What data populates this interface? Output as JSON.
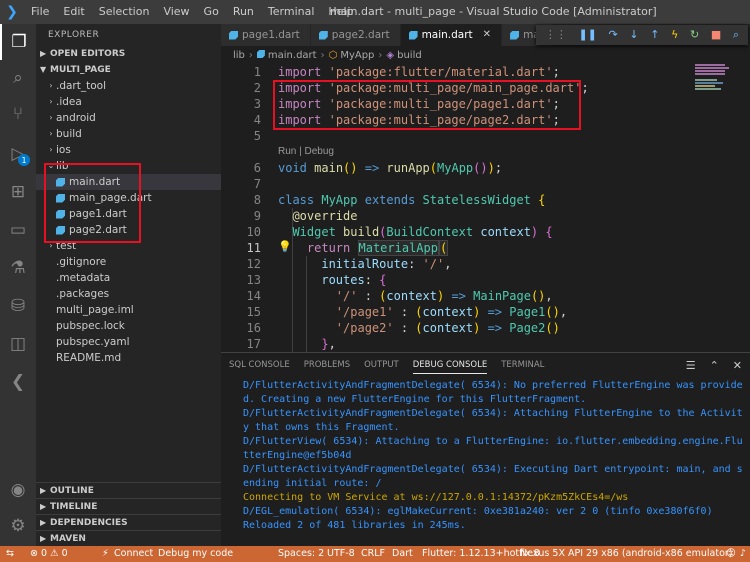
{
  "titlebar": {
    "menu": [
      "File",
      "Edit",
      "Selection",
      "View",
      "Go",
      "Run",
      "Terminal",
      "Help"
    ],
    "window_title": "main.dart - multi_page - Visual Studio Code [Administrator]"
  },
  "sidebar": {
    "title": "EXPLORER",
    "open_editors": "OPEN EDITORS",
    "project": "MULTI_PAGE",
    "tree": [
      {
        "label": ".dart_tool",
        "type": "folder"
      },
      {
        "label": ".idea",
        "type": "folder"
      },
      {
        "label": "android",
        "type": "folder"
      },
      {
        "label": "build",
        "type": "folder"
      },
      {
        "label": "ios",
        "type": "folder"
      },
      {
        "label": "lib",
        "type": "folder-open"
      },
      {
        "label": "main.dart",
        "type": "dart"
      },
      {
        "label": "main_page.dart",
        "type": "dart"
      },
      {
        "label": "page1.dart",
        "type": "dart"
      },
      {
        "label": "page2.dart",
        "type": "dart"
      },
      {
        "label": "test",
        "type": "folder"
      },
      {
        "label": ".gitignore",
        "type": "file"
      },
      {
        "label": ".metadata",
        "type": "file"
      },
      {
        "label": ".packages",
        "type": "file"
      },
      {
        "label": "multi_page.iml",
        "type": "file"
      },
      {
        "label": "pubspec.lock",
        "type": "file"
      },
      {
        "label": "pubspec.yaml",
        "type": "file"
      },
      {
        "label": "README.md",
        "type": "file"
      }
    ],
    "footer": [
      "OUTLINE",
      "TIMELINE",
      "DEPENDENCIES",
      "MAVEN"
    ]
  },
  "tabs": [
    {
      "label": "page1.dart"
    },
    {
      "label": "page2.dart"
    },
    {
      "label": "main.dart"
    },
    {
      "label": "mai"
    }
  ],
  "breadcrumb": {
    "parts": [
      "lib",
      "main.dart",
      "MyApp",
      "build"
    ]
  },
  "editor": {
    "codelens": "Run | Debug",
    "line_numbers": [
      "1",
      "2",
      "3",
      "4",
      "5",
      "6",
      "7",
      "8",
      "9",
      "10",
      "11",
      "12",
      "13",
      "14",
      "15",
      "16",
      "17"
    ],
    "lines": {
      "l1_kw": "import",
      "l1_str": "'package:flutter/material.dart'",
      "l2_kw": "import",
      "l2_str": "'package:multi_page/main_page.dart'",
      "l3_kw": "import",
      "l3_str": "'package:multi_page/page1.dart'",
      "l4_kw": "import",
      "l4_str": "'package:multi_page/page2.dart'",
      "l6_void": "void",
      "l6_main": "main",
      "l6_arrow": "=>",
      "l6_run": "runApp",
      "l6_cls": "MyApp",
      "l8_class": "class",
      "l8_name": "MyApp",
      "l8_extends": "extends",
      "l8_parent": "StatelessWidget",
      "l9_dec": "@override",
      "l10_type": "Widget",
      "l10_fn": "build",
      "l10_ctxcls": "BuildContext",
      "l10_ctx": "context",
      "l11_ret": "return",
      "l11_cls": "MaterialApp",
      "l12_prop": "initialRoute",
      "l12_str": "'/'",
      "l13_prop": "routes",
      "l14_str": "'/'",
      "l14_ctx": "context",
      "l14_cls": "MainPage",
      "l15_str": "'/page1'",
      "l15_ctx": "context",
      "l15_cls": "Page1",
      "l16_str": "'/page2'",
      "l16_ctx": "context",
      "l16_cls": "Page2"
    }
  },
  "panel": {
    "tabs": [
      "SQL CONSOLE",
      "PROBLEMS",
      "OUTPUT",
      "DEBUG CONSOLE",
      "TERMINAL"
    ],
    "console": [
      "D/FlutterActivityAndFragmentDelegate( 6534): No preferred FlutterEngine was provided. Creating a new FlutterEngine for this FlutterFragment.",
      "D/FlutterActivityAndFragmentDelegate( 6534): Attaching FlutterEngine to the Activity that owns this Fragment.",
      "D/FlutterView( 6534): Attaching to a FlutterEngine: io.flutter.embedding.engine.FlutterEngine@ef5b04d",
      "D/FlutterActivityAndFragmentDelegate( 6534): Executing Dart entrypoint: main, and sending initial route: /",
      "Connecting to VM Service at ws://127.0.0.1:14372/pKzm5ZkCEs4=/ws",
      "D/EGL_emulation( 6534): eglMakeCurrent: 0xe381a240: ver 2 0 (tinfo 0xe380f6f0)",
      "Reloaded 2 of 481 libraries in 245ms."
    ]
  },
  "statusbar": {
    "errors": "⊗ 0 ⚠ 0",
    "connect": "Connect",
    "debug": "Debug my code",
    "spaces": "Spaces: 2",
    "encoding": "UTF-8",
    "eol": "CRLF",
    "language": "Dart",
    "flutter": "Flutter: 1.12.13+hotfix.8",
    "device": "Nexus 5X API 29 x86 (android-x86 emulator)"
  },
  "colors": {
    "accent": "#007acc",
    "statusbar": "#cc6633",
    "highlight_box": "#e81123"
  }
}
